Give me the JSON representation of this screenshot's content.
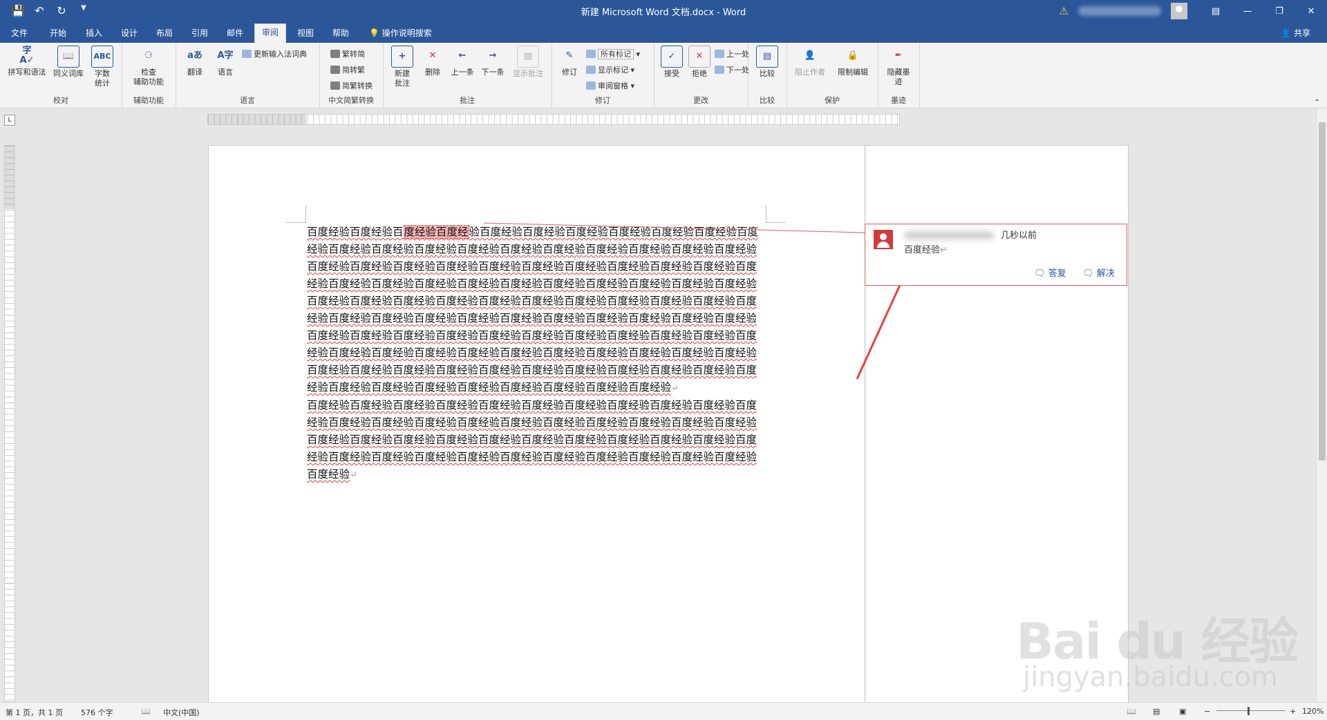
{
  "window": {
    "title": "新建 Microsoft Word 文档.docx  -  Word",
    "qat": [
      "save-icon",
      "undo-icon",
      "redo-icon",
      "customize-icon"
    ],
    "controls": [
      "ribbon-display-icon",
      "minimize-icon",
      "maximize-icon",
      "close-icon"
    ]
  },
  "tabs": [
    {
      "label": "文件"
    },
    {
      "label": "开始"
    },
    {
      "label": "插入"
    },
    {
      "label": "设计"
    },
    {
      "label": "布局"
    },
    {
      "label": "引用"
    },
    {
      "label": "邮件"
    },
    {
      "label": "审阅",
      "active": true
    },
    {
      "label": "视图"
    },
    {
      "label": "帮助"
    }
  ],
  "tell_me": "操作说明搜索",
  "share": "共享",
  "ribbon": {
    "proofing": {
      "group": "校对",
      "spelling": "拼写和语法",
      "thesaurus": "同义词库",
      "wordcount1": "字数",
      "wordcount2": "统计"
    },
    "accessibility": {
      "group": "辅助功能",
      "check1": "检查",
      "check2": "辅助功能"
    },
    "language": {
      "group": "语言",
      "translate": "翻译",
      "language": "语言",
      "ime": "更新输入法词典"
    },
    "chinese": {
      "group": "中文简繁转换",
      "t2s": "繁转简",
      "s2t": "简转繁",
      "convert": "简繁转换"
    },
    "comments": {
      "group": "批注",
      "new1": "新建",
      "new2": "批注",
      "delete": "删除",
      "prev": "上一条",
      "next": "下一条",
      "show": "显示批注"
    },
    "tracking": {
      "group": "修订",
      "track": "修订",
      "markup": "所有标记",
      "show_markup": "显示标记",
      "pane": "审阅窗格"
    },
    "changes": {
      "group": "更改",
      "accept": "接受",
      "reject": "拒绝",
      "prev": "上一处",
      "next": "下一处"
    },
    "compare": {
      "group": "比较",
      "compare": "比较"
    },
    "protect": {
      "group": "保护",
      "block": "阻止作者",
      "restrict": "限制编辑"
    },
    "ink": {
      "group": "墨迹",
      "hide1": "隐藏墨",
      "hide2": "迹"
    }
  },
  "document": {
    "p1_pre": "百度经验百度经验百",
    "p1_hl": "度经验百度经",
    "p1_post": "验百度经验百度经验百度经验百度经验百度经验百度经验百度经验百度经验百度经验百度经验百度经验百度经验百度经验百度经验百度经验百度经验百度经验百度经验百度经验百度经验百度经验百度经验百度经验百度经验百度经验百度经验百度经验百度经验百度经验百度经验百度经验百度经验百度经验百度经验百度经验百度经验百度经验百度经验百度经验百度经验百度经验百度经验百度经验百度经验百度经验百度经验百度经验百度经验百度经验百度经验百度经验百度经验百度经验百度经验百度经验百度经验百度经验百度经验百度经验百度经验百度经验百度经验百度经验百度经验百度经验百度经验百度经验百度经验百度经验百度经验百度经验百度经验百度经验百度经验百度经验百度经验百度经验百度经验百度经验百度经验百度经验百度经验百度经验百度经验百度经验百度经验百度经验百度经验百度经验百度经验百度经验百度经验百度经验百度经验百度经验百度经验百度经验百度经验百度经验",
    "p2": "百度经验百度经验百度经验百度经验百度经验百度经验百度经验百度经验百度经验百度经验百度经验百度经验百度经验百度经验百度经验百度经验百度经验百度经验百度经验百度经验百度经验百度经验百度经验百度经验百度经验百度经验百度经验百度经验百度经验百度经验百度经验百度经验百度经验百度经验百度经验百度经验百度经验百度经验百度经验百度经验百度经验百度经验百度经验"
  },
  "comment": {
    "time": "几秒以前",
    "text": "百度经验",
    "reply": "答复",
    "resolve": "解决"
  },
  "status": {
    "page": "第 1 页，共 1 页",
    "words": "576 个字",
    "lang": "中文(中国)",
    "zoom": "120%"
  },
  "watermark": {
    "brand": "Bai  du 经验",
    "url": "jingyan.baidu.com"
  },
  "colors": {
    "accent": "#2b579a",
    "comment_border": "#e05b5b",
    "arrow": "#e84040"
  }
}
